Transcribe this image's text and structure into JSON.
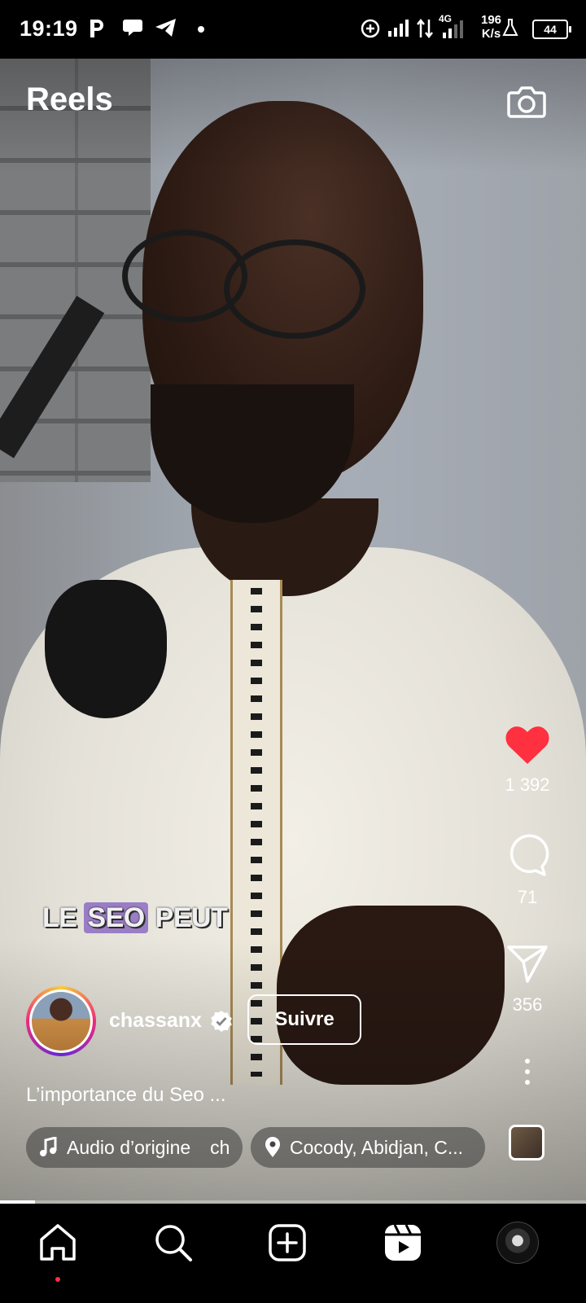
{
  "status_bar": {
    "time": "19:19",
    "network_speed": "196",
    "network_unit": "K/s",
    "network_type": "4G",
    "battery": "44"
  },
  "header": {
    "title": "Reels",
    "camera_icon": "camera-icon"
  },
  "video": {
    "caption_prefix": "LE ",
    "caption_highlight": "SEO",
    "caption_suffix": " PEUT"
  },
  "actions": {
    "likes": "1 392",
    "comments": "71",
    "shares": "356"
  },
  "author": {
    "username": "chassanx",
    "follow_label": "Suivre"
  },
  "post": {
    "description": "L’importance du Seo ...",
    "audio_label": "Audio d’origine",
    "audio_scroll": "ch",
    "location": "Cocody, Abidjan, C..."
  },
  "playback": {
    "progress": 0.06
  },
  "colors": {
    "like": "#ff3040",
    "caption_highlight": "#805cbe"
  }
}
